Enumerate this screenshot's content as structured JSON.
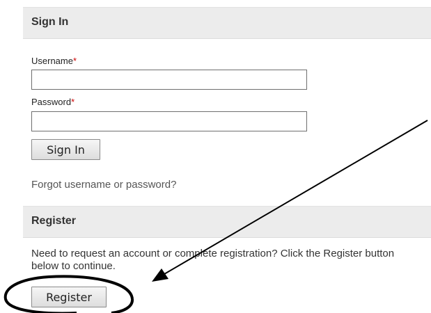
{
  "signin": {
    "title": "Sign In",
    "username_label": "Username",
    "password_label": "Password",
    "required_marker": "*",
    "username_value": "",
    "password_value": "",
    "button_label": "Sign In",
    "forgot_link": "Forgot username or password?"
  },
  "register": {
    "title": "Register",
    "description": "Need to request an account or complete registration? Click the Register button below to continue.",
    "button_label": "Register"
  },
  "annotation": {
    "color": "#000000"
  }
}
